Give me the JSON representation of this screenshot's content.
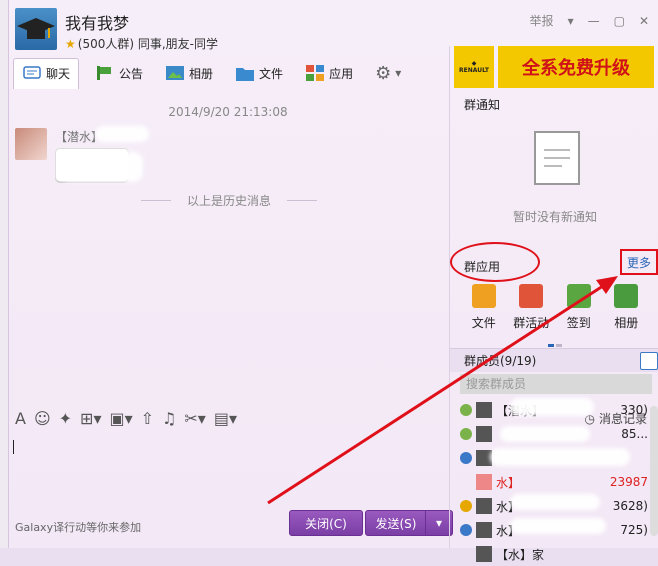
{
  "window": {
    "group_name": "我有我梦",
    "group_sub": "(500人群) 同事,朋友-同学",
    "report_label": "举报"
  },
  "tabs": [
    {
      "label": "聊天"
    },
    {
      "label": "公告"
    },
    {
      "label": "相册"
    },
    {
      "label": "文件"
    },
    {
      "label": "应用"
    }
  ],
  "chat": {
    "timestamp": "2014/9/20 21:13:08",
    "sender_name": "【潜水】",
    "history_label": "以上是历史消息"
  },
  "input": {
    "records_label": "消息记录",
    "footer_text": "Galaxy译行动等你来参加",
    "close_button": "关闭(C)",
    "send_button": "发送(S)"
  },
  "right_panel": {
    "ad_logo_text": "RENAULT",
    "ad_text": "全系免费升级",
    "notice_title": "群通知",
    "notice_empty": "暂时没有新通知",
    "apps_title": "群应用",
    "more_label": "更多",
    "apps": [
      {
        "label": "文件",
        "color": "#f0a020"
      },
      {
        "label": "群活动",
        "color": "#e0553a"
      },
      {
        "label": "签到",
        "color": "#5aa640"
      },
      {
        "label": "相册",
        "color": "#4a9a3e"
      }
    ],
    "members_title": "群成员(9/19)",
    "member_search_placeholder": "搜索群成员",
    "members": [
      {
        "name": "【潜水】",
        "tail": "330)"
      },
      {
        "name": "",
        "tail": "85..."
      },
      {
        "name": "",
        "tail": ""
      },
      {
        "name": "水】",
        "tail": "23987"
      },
      {
        "name": "水】",
        "tail": "3628)"
      },
      {
        "name": "水】",
        "tail": "725)"
      },
      {
        "name": "【水】家",
        "tail": ""
      }
    ]
  },
  "colors": {
    "accent": "#7a3ea4",
    "annotation": "#e0101a",
    "link": "#2a66b8"
  }
}
